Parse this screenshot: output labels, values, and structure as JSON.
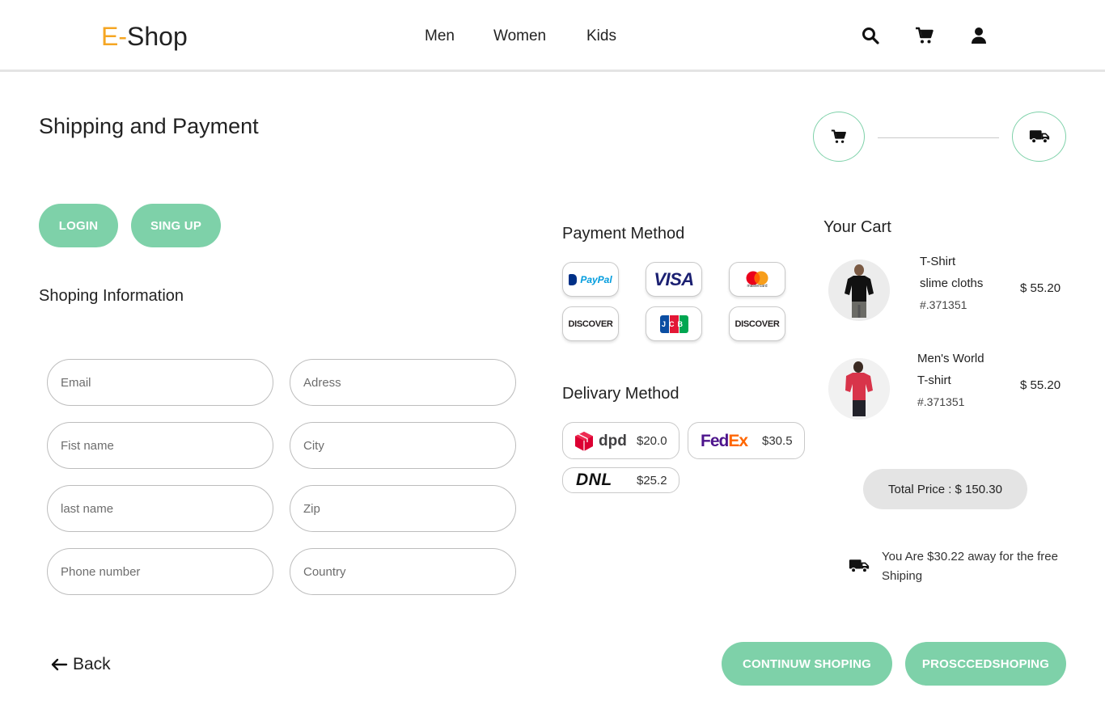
{
  "header": {
    "logo_prefix": "E-",
    "logo_suffix": "Shop",
    "nav": [
      "Men",
      "Women",
      "Kids"
    ],
    "icons": [
      "search-icon",
      "cart-icon",
      "user-icon"
    ]
  },
  "page": {
    "title": "Shipping and Payment",
    "steps": [
      "cart-icon",
      "truck-icon"
    ]
  },
  "auth": {
    "login_label": "LOGIN",
    "signup_label": "SING UP"
  },
  "shipping_info": {
    "heading": "Shoping Information",
    "fields": {
      "email": "Email",
      "address": "Adress",
      "first_name": "Fist name",
      "city": "City",
      "last_name": "last name",
      "zip": "Zip",
      "phone": "Phone number",
      "country": "Country"
    }
  },
  "payment": {
    "heading": "Payment Method",
    "methods": [
      "PayPal",
      "VISA",
      "mastercard",
      "DISCOVER",
      "JCB",
      "DISCOVER"
    ]
  },
  "delivery": {
    "heading": "Delivary Method",
    "options": [
      {
        "name": "dpd",
        "price": "$20.0"
      },
      {
        "name": "FedEx",
        "price": "$30.5"
      },
      {
        "name": "DNL",
        "price": "$25.2"
      }
    ]
  },
  "cart": {
    "heading": "Your Cart",
    "items": [
      {
        "line1": "T-Shirt",
        "line2": "slime cloths",
        "sku": "#.371351",
        "price": "$ 55.20"
      },
      {
        "line1": "Men's World",
        "line2": "T-shirt",
        "sku": "#.371351",
        "price": "$ 55.20"
      }
    ],
    "total": "Total Price : $ 150.30",
    "free_shipping_note": "You Are $30.22 away for the free Shiping"
  },
  "footer": {
    "back_label": "Back",
    "continue_label": "CONTINUW SHOPING",
    "proceed_label": "PROSCCEDSHOPING"
  },
  "colors": {
    "accent": "#7ed1a9",
    "logo_accent": "#f5a623",
    "total_bg": "#e4e4e4"
  }
}
